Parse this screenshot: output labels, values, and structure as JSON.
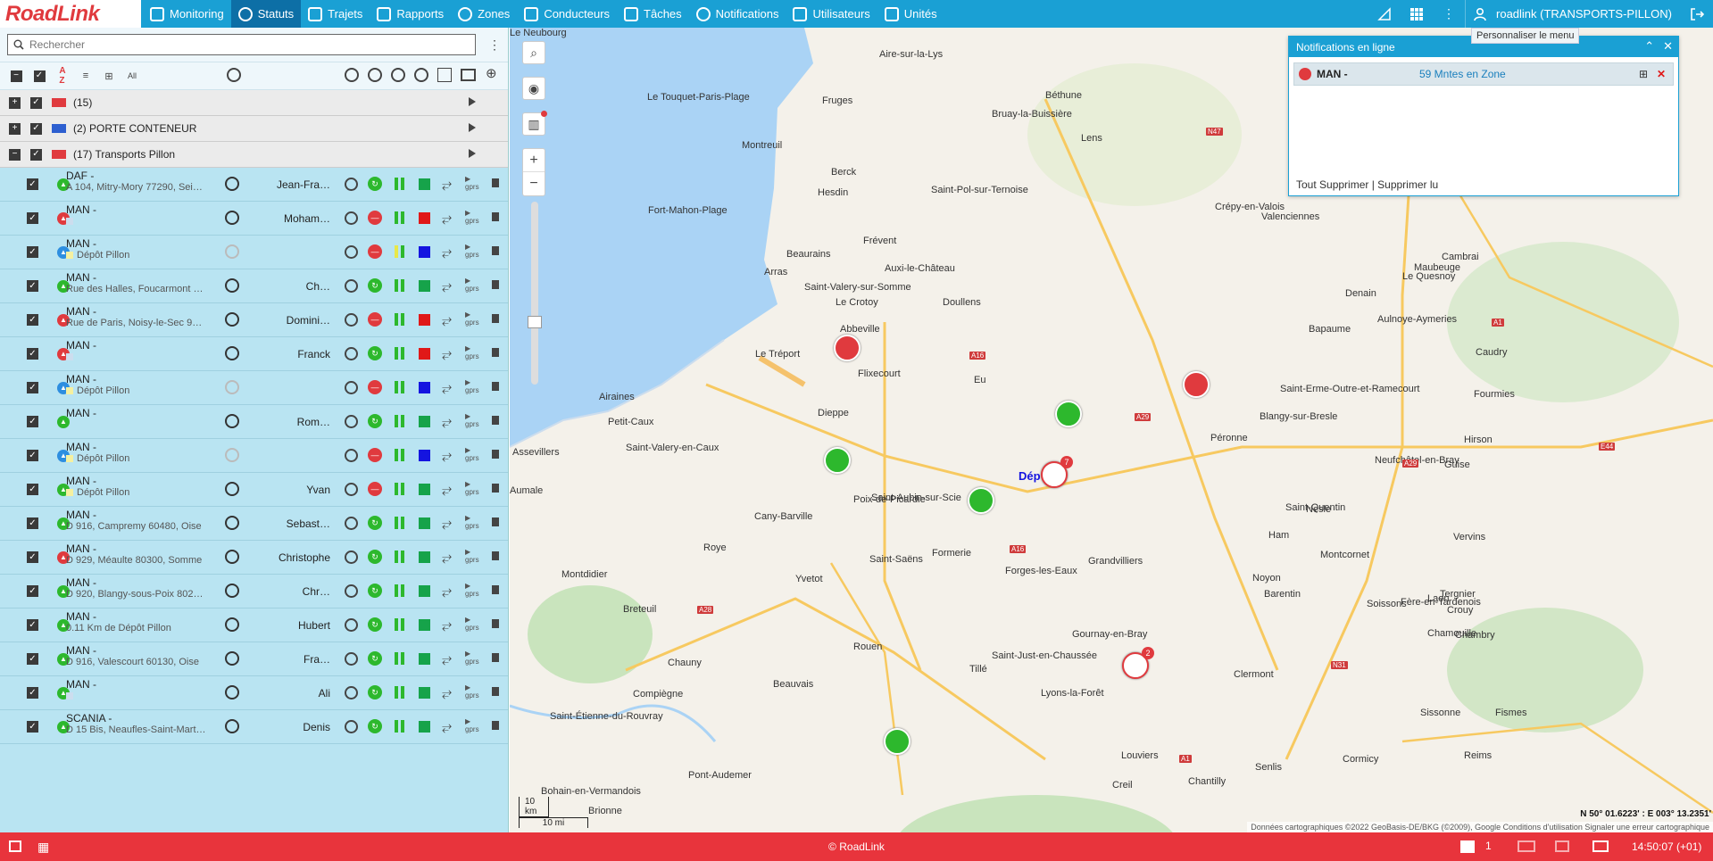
{
  "app": {
    "logo": "RoadLink",
    "user": "roadlink (TRANSPORTS-PILLON)"
  },
  "nav": [
    {
      "label": "Monitoring",
      "icon": "bar-chart-icon"
    },
    {
      "label": "Statuts",
      "icon": "globe-icon",
      "active": true
    },
    {
      "label": "Trajets",
      "icon": "route-flag-icon"
    },
    {
      "label": "Rapports",
      "icon": "report-icon"
    },
    {
      "label": "Zones",
      "icon": "zone-icon"
    },
    {
      "label": "Conducteurs",
      "icon": "steering-wheel-icon"
    },
    {
      "label": "Tâches",
      "icon": "checklist-icon"
    },
    {
      "label": "Notifications",
      "icon": "alarm-clock-icon"
    },
    {
      "label": "Utilisateurs",
      "icon": "user-icon"
    },
    {
      "label": "Unités",
      "icon": "bus-icon"
    }
  ],
  "tooltip": "Personnaliser le menu",
  "search": {
    "placeholder": "Rechercher"
  },
  "toolbar": {
    "all_label": "All"
  },
  "groups": [
    {
      "label": "(15)",
      "sign": "+"
    },
    {
      "label": "(2) PORTE CONTENEUR",
      "sign": "+"
    },
    {
      "label": "(17) Transports Pillon",
      "sign": "−"
    }
  ],
  "vehicles": [
    {
      "name": "DAF -",
      "addr": "A 104, Mitry-Mory 77290, Sei…",
      "driver": "Jean-Fra…",
      "status": "#2db82d",
      "sig": "#2db82d",
      "bar": "#2db82d",
      "box": "#16a34a",
      "zone": ""
    },
    {
      "name": "MAN -",
      "addr": "",
      "driver": "Moham…",
      "status": "#e03a3e",
      "sig": "#e03a3e",
      "bar": "#2db82d",
      "box": "#e01818",
      "zone": "#ccddee"
    },
    {
      "name": "MAN -",
      "addr": "Dépôt Pillon",
      "driver": "",
      "status": "#2d8ee0",
      "sig": "#e03a3e",
      "bar": "#e8e84a",
      "box": "#1414e0",
      "zone": "#f5f0a0"
    },
    {
      "name": "MAN -",
      "addr": "Rue des Halles, Foucarmont …",
      "driver": "Ch…",
      "status": "#2db82d",
      "sig": "#2db82d",
      "bar": "#2db82d",
      "box": "#16a34a",
      "zone": ""
    },
    {
      "name": "MAN -",
      "addr": "Rue de Paris, Noisy-le-Sec 9…",
      "driver": "Domini…",
      "status": "#e03a3e",
      "sig": "#e03a3e",
      "bar": "#2db82d",
      "box": "#e01818",
      "zone": ""
    },
    {
      "name": "MAN -",
      "addr": "",
      "driver": "Franck",
      "status": "#e03a3e",
      "sig": "#2db82d",
      "bar": "#2db82d",
      "box": "#e01818",
      "zone": "#ccddee"
    },
    {
      "name": "MAN -",
      "addr": "Dépôt Pillon",
      "driver": "",
      "status": "#2d8ee0",
      "sig": "#e03a3e",
      "bar": "#2db82d",
      "box": "#1414e0",
      "zone": "#f5f0a0"
    },
    {
      "name": "MAN -",
      "addr": "",
      "driver": "Rom…",
      "status": "#2db82d",
      "sig": "#2db82d",
      "bar": "#2db82d",
      "box": "#16a34a",
      "zone": ""
    },
    {
      "name": "MAN -",
      "addr": "Dépôt Pillon",
      "driver": "",
      "status": "#2d8ee0",
      "sig": "#e03a3e",
      "bar": "#2db82d",
      "box": "#1414e0",
      "zone": "#f5f0a0"
    },
    {
      "name": "MAN -",
      "addr": "Dépôt Pillon",
      "driver": "Yvan",
      "status": "#2db82d",
      "sig": "#e03a3e",
      "bar": "#2db82d",
      "box": "#16a34a",
      "zone": "#f5f0a0"
    },
    {
      "name": "MAN -",
      "addr": "D 916, Campremy 60480, Oise",
      "driver": "Sebast…",
      "status": "#2db82d",
      "sig": "#2db82d",
      "bar": "#2db82d",
      "box": "#16a34a",
      "zone": ""
    },
    {
      "name": "MAN -",
      "addr": "D 929, Méaulte 80300, Somme",
      "driver": "Christophe",
      "status": "#e03a3e",
      "sig": "#2db82d",
      "bar": "#2db82d",
      "box": "#16a34a",
      "zone": ""
    },
    {
      "name": "MAN -",
      "addr": "D 920, Blangy-sous-Poix 802…",
      "driver": "Chr…",
      "status": "#2db82d",
      "sig": "#2db82d",
      "bar": "#2db82d",
      "box": "#16a34a",
      "zone": ""
    },
    {
      "name": "MAN -",
      "addr": "0.11 Km de Dépôt Pillon",
      "driver": "Hubert",
      "status": "#2db82d",
      "sig": "#2db82d",
      "bar": "#2db82d",
      "box": "#16a34a",
      "zone": ""
    },
    {
      "name": "MAN -",
      "addr": "D 916, Valescourt 60130, Oise",
      "driver": "Fra…",
      "status": "#2db82d",
      "sig": "#2db82d",
      "bar": "#2db82d",
      "box": "#16a34a",
      "zone": ""
    },
    {
      "name": "MAN -",
      "addr": "",
      "driver": "Ali",
      "status": "#2db82d",
      "sig": "#2db82d",
      "bar": "#2db82d",
      "box": "#16a34a",
      "zone": "#ccddee"
    },
    {
      "name": "SCANIA -",
      "addr": "D 15 Bis, Neaufles-Saint-Mart…",
      "driver": "Denis",
      "status": "#2db82d",
      "sig": "#2db82d",
      "bar": "#2db82d",
      "box": "#16a34a",
      "zone": ""
    }
  ],
  "map": {
    "cities": [
      "Aire-sur-la-Lys",
      "Béthune",
      "Le Touquet-Paris-Plage",
      "Fruges",
      "Bruay-la-Buissière",
      "Lens",
      "Montreuil",
      "Berck",
      "Hesdin",
      "Saint-Pol-sur-Ternoise",
      "Fort-Mahon-Plage",
      "Frévent",
      "Arras",
      "Beaurains",
      "Le Crotoy",
      "Saint-Valery-sur-Somme",
      "Auxi-le-Château",
      "Doullens",
      "Abbeville",
      "Le Tréport",
      "Bapaume",
      "Flixecourt",
      "Eu",
      "Airaines",
      "Petit-Caux",
      "Dieppe",
      "Blangy-sur-Bresle",
      "Péronne",
      "Assevillers",
      "Saint-Valery-en-Caux",
      "Saint-Aubin-sur-Scie",
      "Poix-de-Picardie",
      "Aumale",
      "Cany-Barville",
      "Neufchâtel-en-Bray",
      "Saint-Quentin",
      "Nesle",
      "Ham",
      "Roye",
      "Saint-Saëns",
      "Formerie",
      "Grandvilliers",
      "Montdidier",
      "Yvetot",
      "Forges-les-Eaux",
      "Breteuil",
      "Barentin",
      "Noyon",
      "Chauny",
      "Rouen",
      "Gournay-en-Bray",
      "Saint-Just-en-Chaussée",
      "Tillé",
      "Beauvais",
      "Lyons-la-Forêt",
      "Clermont",
      "Compiègne",
      "Saint-Étienne-du-Rouvray",
      "Pont-Audemer",
      "Louviers",
      "Creil",
      "Chantilly",
      "Senlis",
      "Crépy-en-Valois",
      "Valenciennes",
      "Denain",
      "Cambrai",
      "Maubeuge",
      "Le Quesnoy",
      "Aulnoye-Aymeries",
      "Caudry",
      "Fourmies",
      "Hirson",
      "Guise",
      "Vervins",
      "Montcornet",
      "Tergnier",
      "Soissons",
      "Crouy",
      "Laon",
      "Chambry",
      "Sissonne",
      "Fismes",
      "Reims",
      "Cormicy",
      "Fère-en-Tardenois",
      "Chamouille",
      "Saint-Erme-Outre-et-Ramecourt",
      "Bohain-en-Vermandois",
      "Brionne",
      "Le Neubourg"
    ],
    "scale_km": "10 km",
    "scale_mi": "10 mi",
    "coords": "N 50° 01.6223' : E 003° 13.2351'",
    "attribution": "Données cartographiques ©2022 GeoBasis-DE/BKG (©2009), Google    Conditions d'utilisation    Signaler une erreur cartographique",
    "depot_label": "Dép",
    "cluster_counts": [
      "7",
      "2"
    ]
  },
  "notifications": {
    "title": "Notifications en ligne",
    "items": [
      {
        "vehicle": "MAN -",
        "message": "59 Mntes en Zone"
      }
    ],
    "footer": "Tout Supprimer | Supprimer lu"
  },
  "statusbar": {
    "copyright": "© RoadLink",
    "count": "1",
    "time": "14:50:07 (+01)"
  }
}
